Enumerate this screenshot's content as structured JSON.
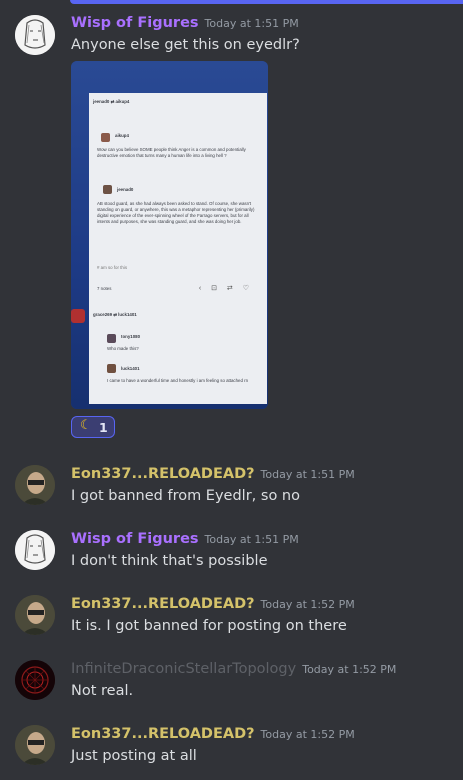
{
  "messages": [
    {
      "author": "Wisp of Figures",
      "timestamp": "Today at 1:51 PM",
      "text": "Anyone else get this on eyedlr?"
    },
    {
      "author": "Eon337...RELOADEAD?",
      "timestamp": "Today at 1:51 PM",
      "text": "I got banned from Eyedlr, so no"
    },
    {
      "author": "Wisp of Figures",
      "timestamp": "Today at 1:51 PM",
      "text": "I don't think that's possible"
    },
    {
      "author": "Eon337...RELOADEAD?",
      "timestamp": "Today at 1:52 PM",
      "text": "It is. I got banned for posting on there"
    },
    {
      "author": "InfiniteDraconicStellarTopology",
      "timestamp": "Today at 1:52 PM",
      "text": "Not real."
    },
    {
      "author": "Eon337...RELOADEAD?",
      "timestamp": "Today at 1:52 PM",
      "text": "Just posting at all"
    }
  ],
  "attachment": {
    "reblog_header": "jeenad0 ⇄ aikup4",
    "user1": "aikup4",
    "post1": "Wow can you believe SOME people think Anger is a common and potentially destructive emotion that turns many a human life into a living hell ?",
    "user2": "jeenad0",
    "post2": "AB stood guard, as she had always been asked to stand. Of course, she wasn't standing on guard, or anywhere, this was a metaphor representing her (primarily) digital experience of the ever-spinning wheel of the Farrago servers, but for all intents and purposes, she was standing guard, and she was doing her job.",
    "tags": "# am so for this",
    "notes": "7 notes",
    "post_icons": "‹ ⊡ ⇄ ♡",
    "reblog_header2": "grace269 ⇄ luck1401",
    "user3": "tony1080",
    "post3": "Who made this?",
    "user4": "luck1401",
    "post4": "I came to have a wonderful time and honestly i am feeling so attached rn"
  },
  "reaction": {
    "emoji": "☾",
    "count": "1"
  },
  "colors": {
    "background": "#313338",
    "purple_name": "#a970ff",
    "yellow_name": "#d4c26a",
    "accent": "#5865f2"
  }
}
